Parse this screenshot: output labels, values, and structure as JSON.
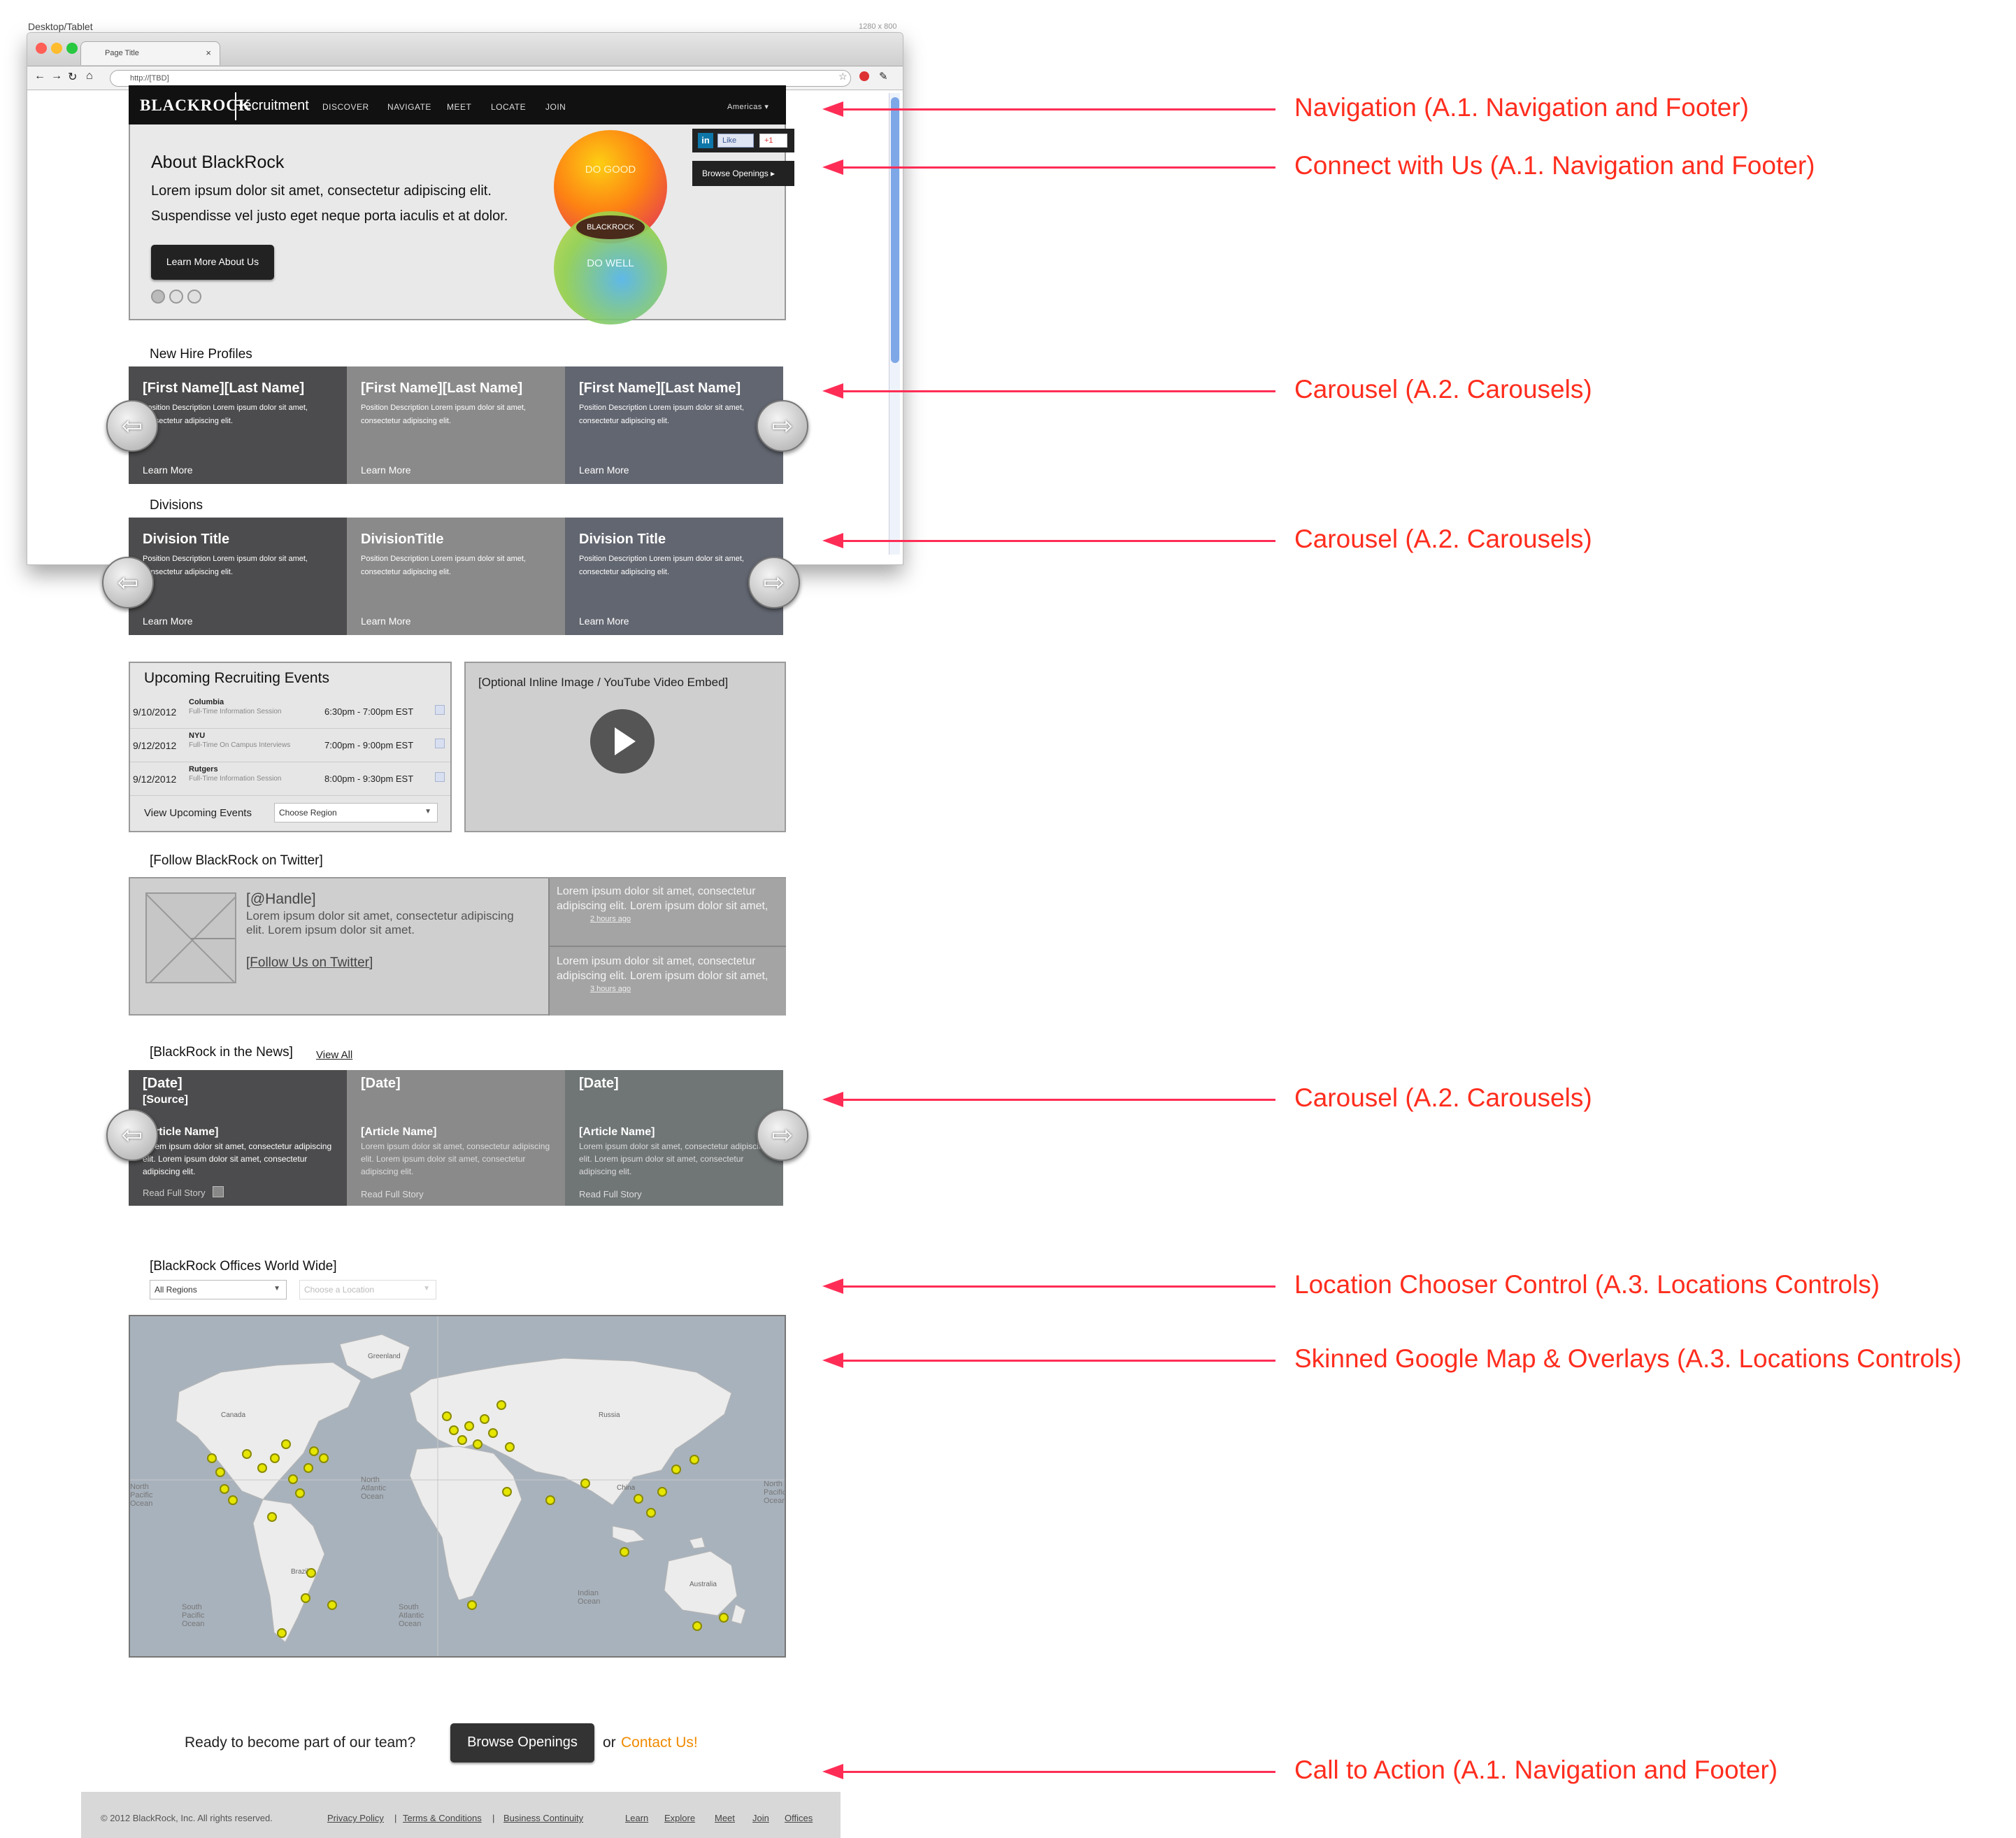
{
  "doc": {
    "label": "Desktop/Tablet",
    "size": "1280 x 800"
  },
  "browser": {
    "tab_title": "Page Title",
    "url": "http://[TBD]"
  },
  "nav": {
    "logo": "BLACKROCK",
    "recruitment": "Recruitment",
    "links": [
      "DISCOVER",
      "NAVIGATE",
      "MEET",
      "LOCATE",
      "JOIN"
    ],
    "region": "Americas ▾"
  },
  "hero": {
    "title": "About BlackRock",
    "text1": "Lorem ipsum dolor sit amet, consectetur adipiscing elit.",
    "text2": "Suspendisse vel justo eget neque porta iaculis et at dolor.",
    "button": "Learn More About Us",
    "do_good": "DO GOOD",
    "do_well": "DO WELL",
    "venn_logo": "BLACKROCK",
    "social": {
      "linkedin": "in",
      "like": "Like",
      "plus": "+1"
    },
    "browse_openings": "Browse Openings ▸"
  },
  "profiles": {
    "title": "New Hire Profiles",
    "cards": [
      {
        "name": "[First Name][Last Name]",
        "desc": "Position Description Lorem ipsum dolor sit amet, consectetur adipiscing elit.",
        "more": "Learn More",
        "color": "#4c4c4e"
      },
      {
        "name": "[First Name][Last Name]",
        "desc": "Position Description Lorem ipsum dolor sit amet, consectetur adipiscing elit.",
        "more": "Learn More",
        "color": "#8a8a8a"
      },
      {
        "name": "[First Name][Last Name]",
        "desc": "Position Description Lorem ipsum dolor sit amet, consectetur adipiscing elit.",
        "more": "Learn More",
        "color": "#626670"
      }
    ]
  },
  "divisions": {
    "title": "Divisions",
    "cards": [
      {
        "name": "Division Title",
        "desc": "Position Description Lorem ipsum dolor sit amet, consectetur adipiscing elit.",
        "more": "Learn More",
        "color": "#4c4c4e"
      },
      {
        "name": "DivisionTitle",
        "desc": "Position Description Lorem ipsum dolor sit amet, consectetur adipiscing elit.",
        "more": "Learn More",
        "color": "#8a8a8a"
      },
      {
        "name": "Division Title",
        "desc": "Position Description Lorem ipsum dolor sit amet, consectetur adipiscing elit.",
        "more": "Learn More",
        "color": "#626670"
      }
    ]
  },
  "events": {
    "title": "Upcoming Recruiting Events",
    "rows": [
      {
        "date": "9/10/2012",
        "school": "Columbia",
        "type": "Full-Time Information Session",
        "time": "6:30pm - 7:00pm EST"
      },
      {
        "date": "9/12/2012",
        "school": "NYU",
        "type": "Full-Time On Campus Interviews",
        "time": "7:00pm - 9:00pm EST"
      },
      {
        "date": "9/12/2012",
        "school": "Rutgers",
        "type": "Full-Time Information Session",
        "time": "8:00pm - 9:30pm EST"
      }
    ],
    "view_label": "View Upcoming Events",
    "region_select": "Choose Region"
  },
  "video": {
    "label": "[Optional Inline Image / YouTube Video Embed]"
  },
  "twitter": {
    "title": "[Follow BlackRock on Twitter]",
    "handle": "[@Handle]",
    "text": "Lorem ipsum dolor sit amet, consectetur adipiscing elit.  Lorem ipsum dolor sit amet.",
    "follow": "[Follow Us on Twitter]",
    "tweets": [
      {
        "text": "Lorem ipsum dolor sit amet, consectetur adipiscing elit.  Lorem ipsum dolor sit amet,",
        "link": "2 hours ago"
      },
      {
        "text": "Lorem ipsum dolor sit amet, consectetur adipiscing elit.  Lorem ipsum dolor sit amet,",
        "link": "3 hours ago"
      }
    ]
  },
  "news": {
    "title": "[BlackRock in the News]",
    "view_all": "View All",
    "cards": [
      {
        "date": "[Date]",
        "source": "[Source]",
        "article": "[Article Name]",
        "text": "Lorem ipsum dolor sit amet, consectetur adipiscing elit.  Lorem ipsum dolor sit amet, consectetur adipiscing elit.",
        "read": "Read Full Story",
        "color": "#4c4c4e"
      },
      {
        "date": "[Date]",
        "source": "",
        "article": "[Article Name]",
        "text": "Lorem ipsum dolor sit amet, consectetur adipiscing elit.  Lorem ipsum dolor sit amet, consectetur adipiscing elit.",
        "read": "Read Full Story",
        "color": "#8a8a8a"
      },
      {
        "date": "[Date]",
        "source": "",
        "article": "[Article Name]",
        "text": "Lorem ipsum dolor sit amet, consectetur adipiscing elit.  Lorem ipsum dolor sit amet, consectetur adipiscing elit.",
        "read": "Read Full Story",
        "color": "#707575"
      }
    ]
  },
  "offices": {
    "title": "[BlackRock Offices World Wide]",
    "region": "All Regions",
    "location": "Choose a Location",
    "map_labels": {
      "north_pacific": "North Pacific Ocean",
      "north_atlantic": "North Atlantic Ocean",
      "south_pacific": "South Pacific Ocean",
      "south_atlantic": "South Atlantic Ocean",
      "indian": "Indian Ocean",
      "n_pacific_right": "North Pacific Ocean",
      "greenland": "Greenland",
      "russia": "Russia",
      "china": "China",
      "brazil": "Brazil",
      "australia": "Australia",
      "canada": "Canada"
    }
  },
  "cta": {
    "question": "Ready to become part of our team?",
    "button": "Browse Openings",
    "or": "or",
    "contact": "Contact Us!"
  },
  "footer": {
    "copyright": "© 2012 BlackRock, Inc. All rights reserved.",
    "policy": "Privacy Policy",
    "sep1": "|",
    "terms": "Terms & Conditions",
    "sep2": "|",
    "continuity": "Business Continuity",
    "links": [
      "Learn",
      "Explore",
      "Meet",
      "Join",
      "Offices"
    ]
  },
  "annotations": [
    "Navigation (A.1. Navigation and Footer)",
    "Connect with Us (A.1. Navigation and Footer)",
    "Carousel (A.2. Carousels)",
    "Carousel (A.2. Carousels)",
    "Carousel (A.2. Carousels)",
    "Location Chooser Control (A.3. Locations Controls)",
    "Skinned Google Map & Overlays (A.3. Locations Controls)",
    "Call to Action (A.1. Navigation and Footer)"
  ],
  "colors": {
    "annotation": "#ff2d55",
    "nav_bg": "#111111",
    "contact": "#f08a00",
    "pin": "#e6e600"
  }
}
